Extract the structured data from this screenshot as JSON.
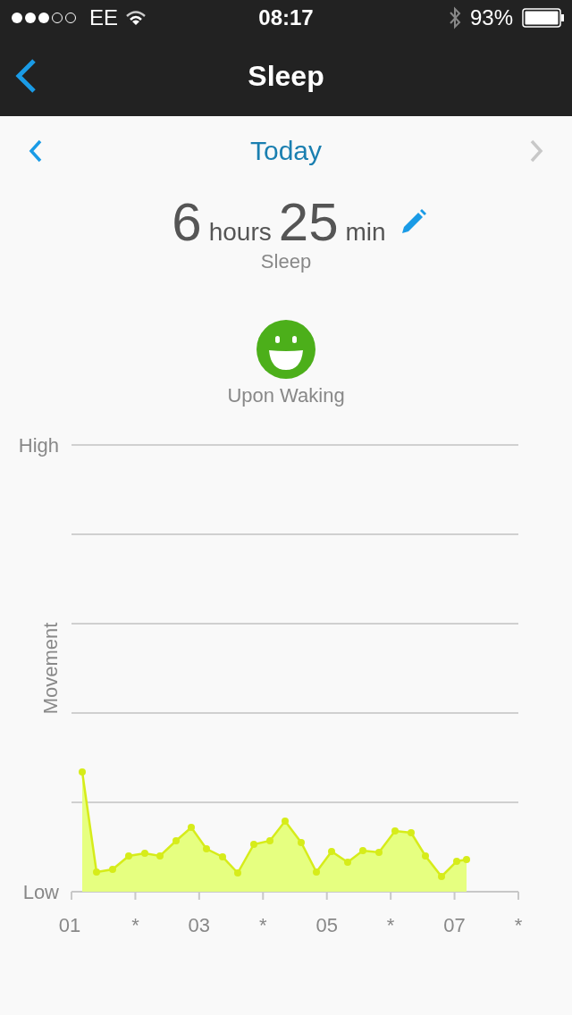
{
  "status_bar": {
    "carrier": "EE",
    "time": "08:17",
    "battery": "93%"
  },
  "nav_bar": {
    "title": "Sleep"
  },
  "date_nav": {
    "label": "Today",
    "prev": {
      "disabled": false
    },
    "next": {
      "disabled": true
    }
  },
  "summary": {
    "hours": "6",
    "hours_unit": "hours",
    "minutes": "25",
    "minutes_unit": "min",
    "caption": "Sleep"
  },
  "mood": {
    "label": "Upon Waking"
  },
  "chart": {
    "y_title": "Movement",
    "y_labels": [
      "High",
      "Low"
    ],
    "x_labels": [
      "01",
      "*",
      "03",
      "*",
      "05",
      "*",
      "07",
      "*"
    ]
  }
}
